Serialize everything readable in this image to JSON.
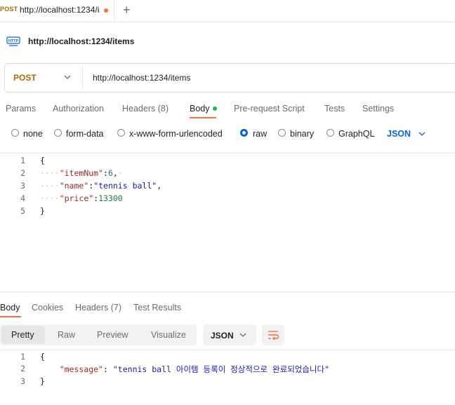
{
  "tab": {
    "method": "POST",
    "title": "http://localhost:1234/i"
  },
  "request": {
    "title": "http://localhost:1234/items",
    "method": "POST",
    "url": "http://localhost:1234/items"
  },
  "request_tabs": [
    "Params",
    "Authorization",
    "Headers (8)",
    "Body",
    "Pre-request Script",
    "Tests",
    "Settings"
  ],
  "body_types": [
    "none",
    "form-data",
    "x-www-form-urlencoded",
    "raw",
    "binary",
    "GraphQL"
  ],
  "body_language": "JSON",
  "request_body": {
    "line_numbers": [
      "1",
      "2",
      "3",
      "4",
      "5"
    ],
    "open_brace": "{",
    "close_brace": "}",
    "key1": "\"itemNum\"",
    "val1": "6",
    "key2": "\"name\"",
    "val2": "\"tennis ball\"",
    "key3": "\"price\"",
    "val3": "13300"
  },
  "response_tabs": [
    "Body",
    "Cookies",
    "Headers (7)",
    "Test Results"
  ],
  "response_views": [
    "Pretty",
    "Raw",
    "Preview",
    "Visualize"
  ],
  "response_format": "JSON",
  "response_body": {
    "line_numbers": [
      "1",
      "2",
      "3"
    ],
    "open_brace": "{",
    "close_brace": "}",
    "key": "\"message\"",
    "value": "\"tennis ball 아이템 등록이 정상적으로 완료되었습니다\""
  },
  "colors": {
    "accent": "#ff6c37",
    "method": "#a66c00",
    "link": "#0265d2",
    "status_dot": "#0cbb52"
  }
}
